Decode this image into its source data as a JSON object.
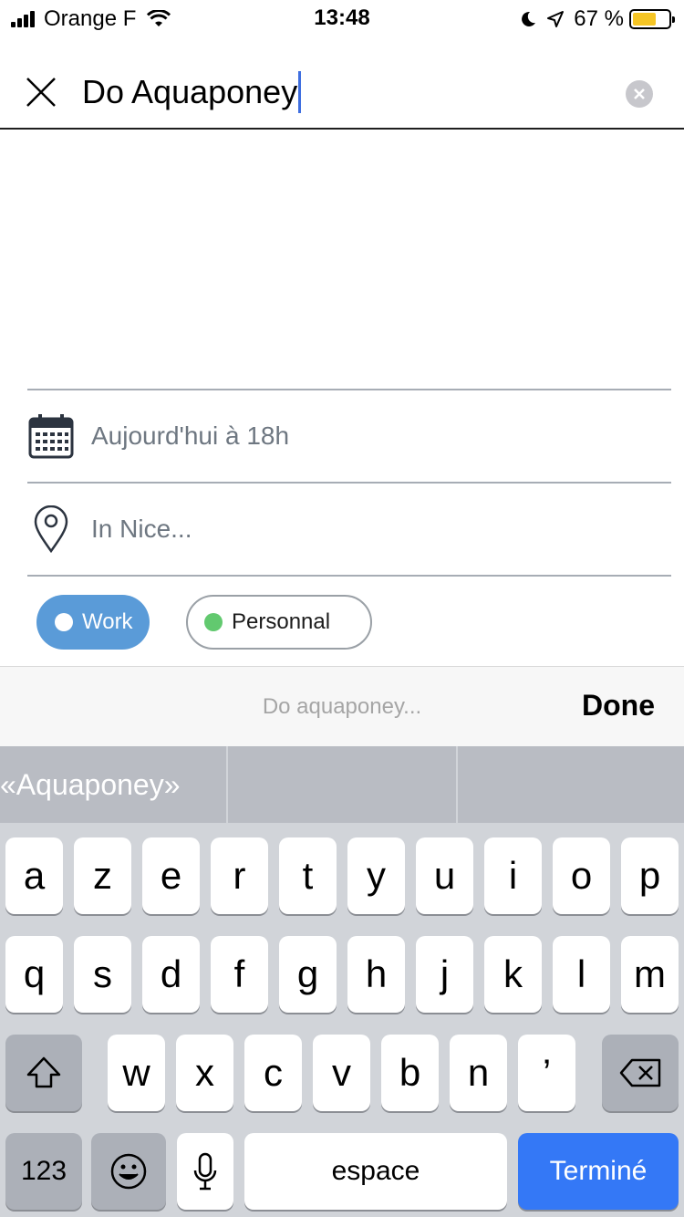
{
  "status_bar": {
    "carrier": "Orange F",
    "time": "13:48",
    "battery_text": "67 %",
    "battery_level": 0.67,
    "icons": [
      "signal-icon",
      "wifi-icon",
      "moon-icon",
      "location-arrow-icon",
      "battery-icon"
    ]
  },
  "header": {
    "title_value": "Do Aquaponey",
    "close_icon": "close-icon",
    "clear_icon": "clear-circle-icon"
  },
  "form": {
    "date_text": "Aujourd'hui à 18h",
    "location_text": "In Nice..."
  },
  "tags": {
    "work_label": "Work",
    "personal_label": "Personnal",
    "work_color": "#5a9bd8",
    "personal_dot_color": "#62c96f"
  },
  "toolbar": {
    "hint": "Do aquaponey...",
    "done_label": "Done"
  },
  "keyboard": {
    "suggestion": "«Aquaponey»",
    "row1": [
      "a",
      "z",
      "e",
      "r",
      "t",
      "y",
      "u",
      "i",
      "o",
      "p"
    ],
    "row2": [
      "q",
      "s",
      "d",
      "f",
      "g",
      "h",
      "j",
      "k",
      "l",
      "m"
    ],
    "row3": [
      "w",
      "x",
      "c",
      "v",
      "b",
      "n",
      "’"
    ],
    "numbers_label": "123",
    "space_label": "espace",
    "return_label": "Terminé",
    "return_color": "#3478f6"
  }
}
